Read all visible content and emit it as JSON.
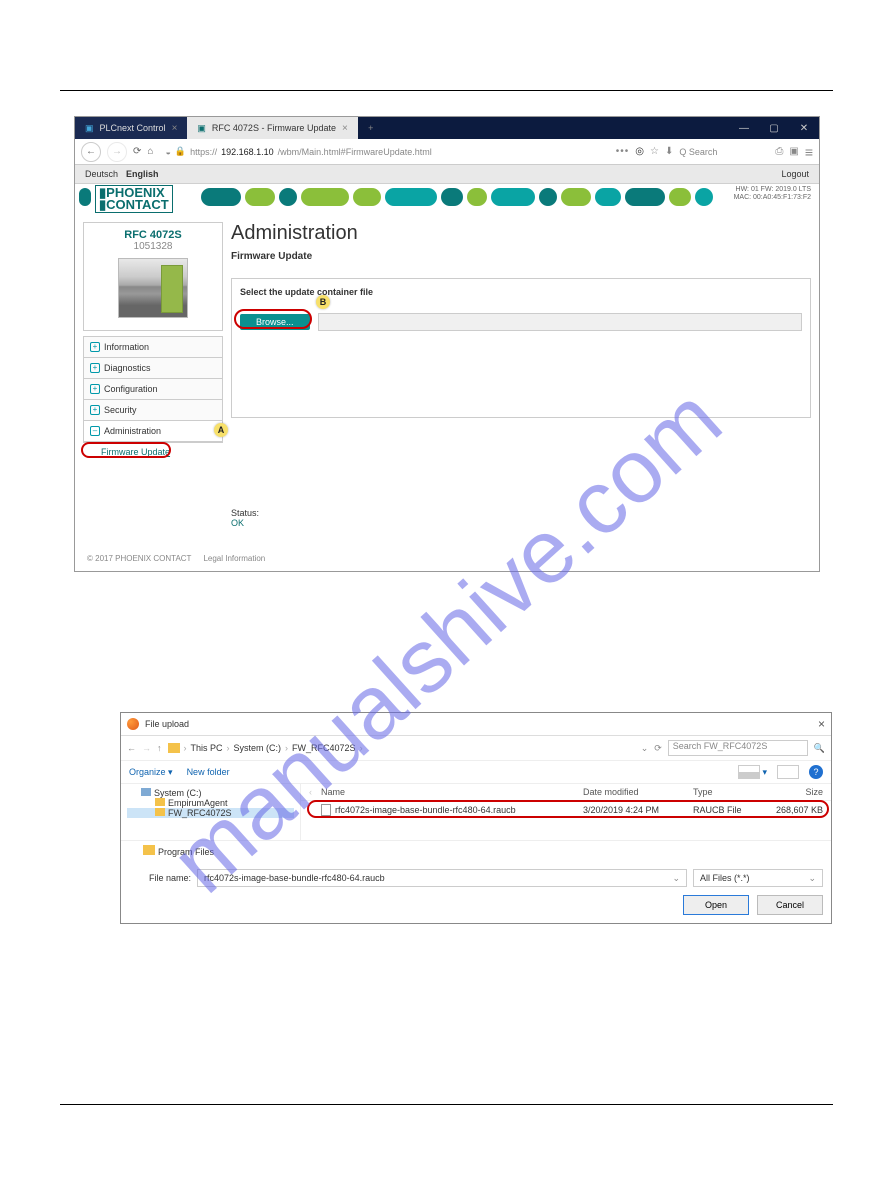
{
  "watermark": "manualshive.com",
  "browser": {
    "tabs": [
      {
        "icon": "P",
        "label": "PLCnext Control"
      },
      {
        "icon": "P",
        "label": "RFC 4072S - Firmware Update"
      }
    ],
    "url_https": "https://",
    "url_host": "192.168.1.10",
    "url_path": "/wbm/Main.html#FirmwareUpdate.html",
    "search_placeholder": "Search",
    "search_prefix": "Q"
  },
  "langbar": {
    "de": "Deutsch",
    "en": "English",
    "logout": "Logout"
  },
  "brand": "PHOENIX\nCONTACT",
  "hw_line1": "HW: 01 FW: 2019.0 LTS",
  "hw_line2": "MAC: 00:A0:45:F1:73:F2",
  "device": {
    "name": "RFC 4072S",
    "num": "1051328"
  },
  "nav": {
    "information": "Information",
    "diagnostics": "Diagnostics",
    "configuration": "Configuration",
    "security": "Security",
    "administration": "Administration",
    "firmware_update": "Firmware Update"
  },
  "markers": {
    "a": "A",
    "b": "B"
  },
  "admin": {
    "title": "Administration",
    "subtitle": "Firmware Update",
    "panel_label": "Select the update container file",
    "browse": "Browse...",
    "status_label": "Status:",
    "status_value": "OK"
  },
  "footer": {
    "copyright": "© 2017 PHOENIX CONTACT",
    "legal": "Legal Information"
  },
  "dialog": {
    "title": "File upload",
    "bc": {
      "thispc": "This PC",
      "sysc": "System (C:)",
      "fw": "FW_RFC4072S"
    },
    "search_placeholder": "Search FW_RFC4072S",
    "organize": "Organize",
    "newfolder": "New folder",
    "tree": {
      "sysc": "System (C:)",
      "emp": "EmpirumAgent",
      "fw": "FW_RFC4072S"
    },
    "cols": {
      "name": "Name",
      "date": "Date modified",
      "type": "Type",
      "size": "Size"
    },
    "file": {
      "name": "rfc4072s-image-base-bundle-rfc480-64.raucb",
      "date": "3/20/2019 4:24 PM",
      "type": "RAUCB File",
      "size": "268,607 KB"
    },
    "program_files": "Program Files",
    "filename_label": "File name:",
    "filter": "All Files (*.*)",
    "open": "Open",
    "cancel": "Cancel"
  }
}
